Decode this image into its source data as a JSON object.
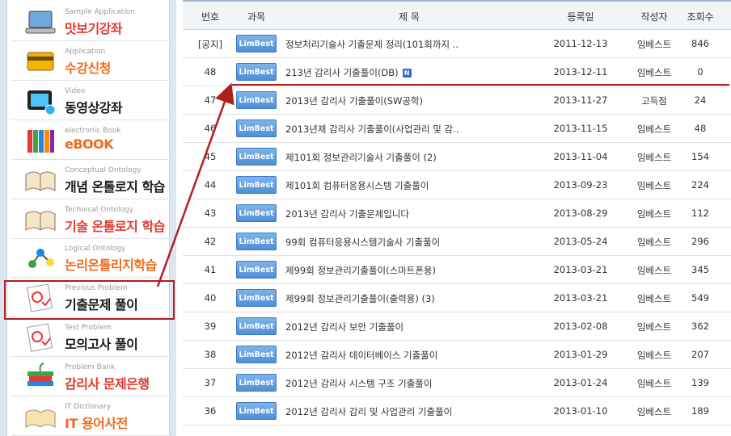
{
  "sidebar": {
    "items": [
      {
        "sub": "Sample Application",
        "main": "맛보기강좌",
        "color": "red",
        "icon": "laptop-icon"
      },
      {
        "sub": "Application",
        "main": "수강신청",
        "color": "orange",
        "icon": "credit-card-icon"
      },
      {
        "sub": "Video",
        "main": "동영상강좌",
        "color": "black",
        "icon": "tv-icon"
      },
      {
        "sub": "electronic Book",
        "main": "eBOOK",
        "color": "orange",
        "icon": "books-icon"
      },
      {
        "sub": "Conceptual Ontology",
        "main": "개념 온톨로지 학습",
        "color": "black",
        "icon": "open-book-icon"
      },
      {
        "sub": "Technical Ontology",
        "main": "기술 온톨로지 학습",
        "color": "red",
        "icon": "open-book-icon"
      },
      {
        "sub": "Logical Ontology",
        "main": "논리온톨리지학습",
        "color": "orange",
        "icon": "molecule-icon"
      },
      {
        "sub": "Previous Problem",
        "main": "기출문제 풀이",
        "color": "black",
        "icon": "exam-paper-icon"
      },
      {
        "sub": "Test Problem",
        "main": "모의고사 풀이",
        "color": "black",
        "icon": "exam-paper-icon"
      },
      {
        "sub": "Problem Bank",
        "main": "감리사 문제은행",
        "color": "red",
        "icon": "book-stack-icon"
      },
      {
        "sub": "IT Dictionary",
        "main": "IT 용어사전",
        "color": "orange",
        "icon": "dictionary-icon"
      }
    ]
  },
  "board": {
    "headers": {
      "num": "번호",
      "subject": "과목",
      "title": "제 목",
      "date": "등록일",
      "author": "작성자",
      "views": "조회수"
    },
    "badge_label": "LimBest",
    "new_mark": "N",
    "rows": [
      {
        "num": "[공지]",
        "title": "정보처리기술사 기출문제 정리(101회까지 ..",
        "date": "2011-12-13",
        "author": "임베스트",
        "views": "846",
        "new": false
      },
      {
        "num": "48",
        "title": "213년 감리사 기출풀이(DB)",
        "date": "2013-12-11",
        "author": "임베스트",
        "views": "0",
        "new": true
      },
      {
        "num": "47",
        "title": "2013년 감리사 기출풀이(SW공학)",
        "date": "2013-11-27",
        "author": "고득점",
        "views": "24",
        "new": false
      },
      {
        "num": "46",
        "title": "2013년제 감리사 기출풀이(사업관리 및 감..",
        "date": "2013-11-15",
        "author": "임베스트",
        "views": "48",
        "new": false
      },
      {
        "num": "45",
        "title": "제101회 정보관리기술사 기출풀이 (2)",
        "date": "2013-11-04",
        "author": "임베스트",
        "views": "154",
        "new": false
      },
      {
        "num": "44",
        "title": "제101회 컴퓨터응용시스템 기출풀이",
        "date": "2013-09-23",
        "author": "임베스트",
        "views": "224",
        "new": false
      },
      {
        "num": "43",
        "title": "2013년 감리사 기출문제입니다",
        "date": "2013-08-29",
        "author": "임베스트",
        "views": "112",
        "new": false
      },
      {
        "num": "42",
        "title": "99회 컴퓨터응용시스템기술사 기출풀이",
        "date": "2013-05-24",
        "author": "임베스트",
        "views": "296",
        "new": false
      },
      {
        "num": "41",
        "title": "제99회 정보관리기출풀이(스마트폰용)",
        "date": "2013-03-21",
        "author": "임베스트",
        "views": "345",
        "new": false
      },
      {
        "num": "40",
        "title": "제99회 정보관리기출풀이(출력용) (3)",
        "date": "2013-03-21",
        "author": "임베스트",
        "views": "549",
        "new": false
      },
      {
        "num": "39",
        "title": "2012년 감리사 보안 기출풀이",
        "date": "2013-02-08",
        "author": "임베스트",
        "views": "362",
        "new": false
      },
      {
        "num": "38",
        "title": "2012년 감리사 데이터베이스 기출풀이",
        "date": "2013-01-29",
        "author": "임베스트",
        "views": "207",
        "new": false
      },
      {
        "num": "37",
        "title": "2012년 감리사 시스템 구조 기출풀이",
        "date": "2013-01-24",
        "author": "임베스트",
        "views": "139",
        "new": false
      },
      {
        "num": "36",
        "title": "2012년 감리사 감리 및 사업관리 기출풀이",
        "date": "2013-01-10",
        "author": "임베스트",
        "views": "189",
        "new": false
      }
    ]
  },
  "colors": {
    "accent_red": "#b01e1e",
    "badge_blue": "#4f8fd6",
    "menu_red": "#e03a2f",
    "menu_orange": "#f06a1c"
  }
}
